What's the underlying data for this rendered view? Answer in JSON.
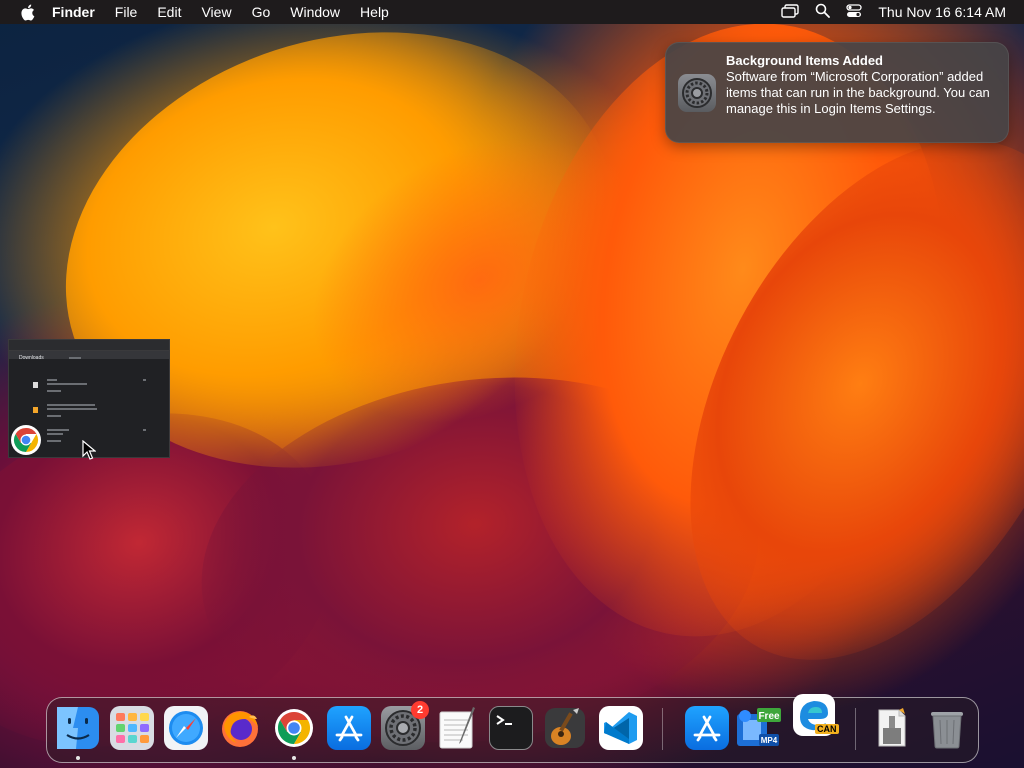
{
  "menubar": {
    "app_name": "Finder",
    "menus": [
      "File",
      "Edit",
      "View",
      "Go",
      "Window",
      "Help"
    ],
    "clock": "Thu Nov 16  6:14 AM",
    "status_icons": [
      "screen-mirroring-icon",
      "search-icon",
      "control-center-icon"
    ]
  },
  "notification": {
    "title": "Background Items Added",
    "body": "Software from “Microsoft Corporation” added items that can run in the background. You can manage this in Login Items Settings.",
    "icon": "system-settings-icon"
  },
  "dock": {
    "apps": [
      {
        "name": "Finder",
        "icon": "finder-icon",
        "running": true
      },
      {
        "name": "Launchpad",
        "icon": "launchpad-icon",
        "running": false
      },
      {
        "name": "Safari",
        "icon": "safari-icon",
        "running": false
      },
      {
        "name": "Firefox",
        "icon": "firefox-icon",
        "running": false
      },
      {
        "name": "Google Chrome",
        "icon": "chrome-icon",
        "running": true
      },
      {
        "name": "App Store",
        "icon": "app-store-icon",
        "running": false
      },
      {
        "name": "System Settings",
        "icon": "system-settings-icon",
        "badge": "2",
        "running": false
      },
      {
        "name": "TextEdit",
        "icon": "textedit-icon",
        "running": false
      },
      {
        "name": "Terminal",
        "icon": "terminal-icon",
        "running": false
      },
      {
        "name": "GarageBand",
        "icon": "garageband-icon",
        "running": false
      },
      {
        "name": "Visual Studio Code",
        "icon": "vscode-icon",
        "running": false
      }
    ],
    "recent": [
      {
        "name": "App Store",
        "icon": "app-store-icon"
      },
      {
        "name": "Free MP4 Converter",
        "icon": "mp4-converter-icon",
        "label_top": "Free",
        "label_bottom": "MP4"
      },
      {
        "name": "Microsoft Edge Canary",
        "icon": "edge-canary-icon",
        "label": "CAN"
      }
    ],
    "others": [
      {
        "name": "Archive Utility",
        "icon": "archive-icon"
      },
      {
        "name": "Trash",
        "icon": "trash-icon"
      }
    ]
  },
  "window_preview": {
    "app": "Google Chrome",
    "title": "Downloads"
  }
}
